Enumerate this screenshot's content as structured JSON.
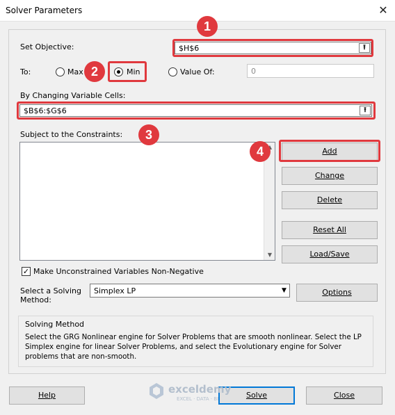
{
  "window": {
    "title": "Solver Parameters",
    "close_glyph": "✕"
  },
  "objective": {
    "label": "Set Objective:",
    "value": "$H$6",
    "ref_glyph": "⭱"
  },
  "to": {
    "label": "To:",
    "max_label": "Max",
    "min_label": "Min",
    "value_of_label": "Value Of:",
    "value_of_value": "0",
    "selected": "Min"
  },
  "changing": {
    "label": "By Changing Variable Cells:",
    "value": "$B$6:$G$6",
    "ref_glyph": "⭱"
  },
  "constraints": {
    "label": "Subject to the Constraints:",
    "items": [],
    "scroll_up": "▲",
    "scroll_down": "▼"
  },
  "side_buttons": {
    "add": "Add",
    "change": "Change",
    "delete": "Delete",
    "reset_all": "Reset All",
    "load_save": "Load/Save"
  },
  "nonneg": {
    "label": "Make Unconstrained Variables Non-Negative",
    "checked": true,
    "glyph": "✓"
  },
  "method": {
    "label_line1": "Select a Solving",
    "label_line2": "Method:",
    "value": "Simplex LP",
    "dropdown_glyph": "▼",
    "options_button": "Options"
  },
  "solving_method": {
    "heading": "Solving Method",
    "text_line1": "Select the GRG Nonlinear engine for Solver Problems that are smooth nonlinear. Select the LP",
    "text_line2": "Simplex engine for linear Solver Problems, and select the Evolutionary engine for Solver",
    "text_line3": "problems that are non-smooth."
  },
  "bottom_buttons": {
    "help": "Help",
    "solve": "Solve",
    "close": "Close"
  },
  "watermark": {
    "brand": "exceldemy",
    "tagline": "EXCEL · DATA · BI"
  },
  "badges": [
    "1",
    "2",
    "3",
    "4"
  ],
  "colors": {
    "highlight": "#e0393e",
    "dialog_bg": "#f0f0f0",
    "solve_border": "#0078d7"
  }
}
